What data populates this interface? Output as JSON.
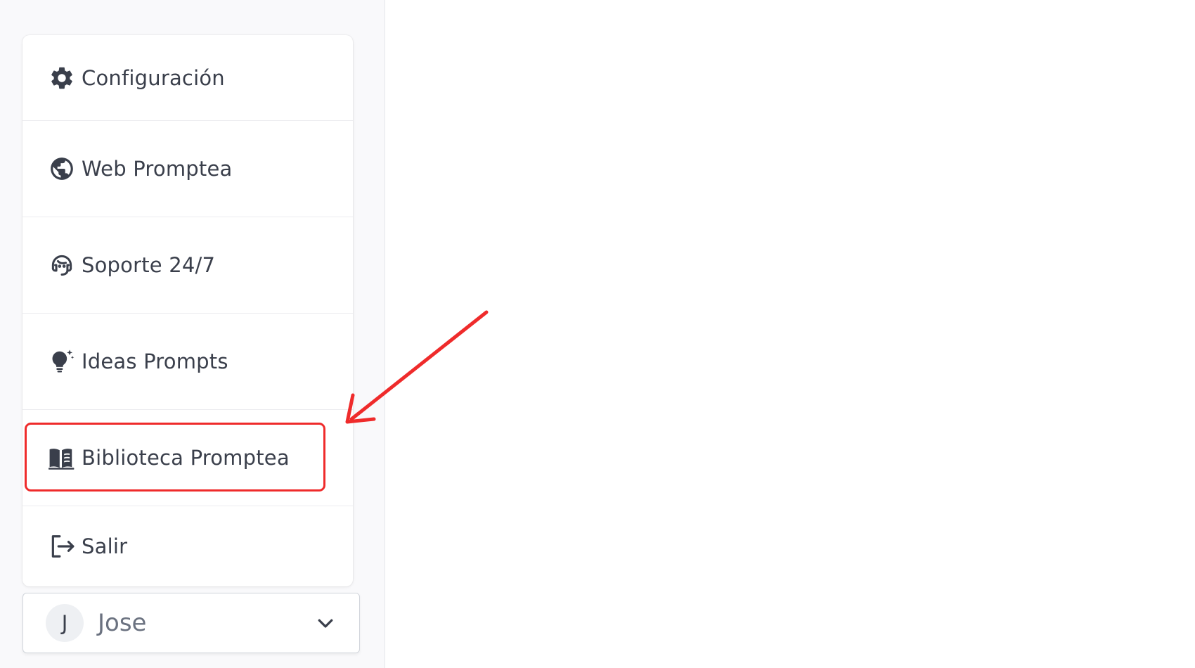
{
  "menu": {
    "items": [
      {
        "label": "Configuración",
        "icon": "gear-icon"
      },
      {
        "label": "Web Promptea",
        "icon": "globe-icon"
      },
      {
        "label": "Soporte 24/7",
        "icon": "headset-icon"
      },
      {
        "label": "Ideas Prompts",
        "icon": "lightbulb-sparkle-icon"
      },
      {
        "label": "Biblioteca Promptea",
        "icon": "book-icon"
      },
      {
        "label": "Salir",
        "icon": "logout-icon"
      }
    ]
  },
  "user": {
    "initial": "J",
    "name": "Jose"
  },
  "annotation": {
    "color": "#ef2b2b",
    "highlighted_item": "Biblioteca Promptea"
  }
}
